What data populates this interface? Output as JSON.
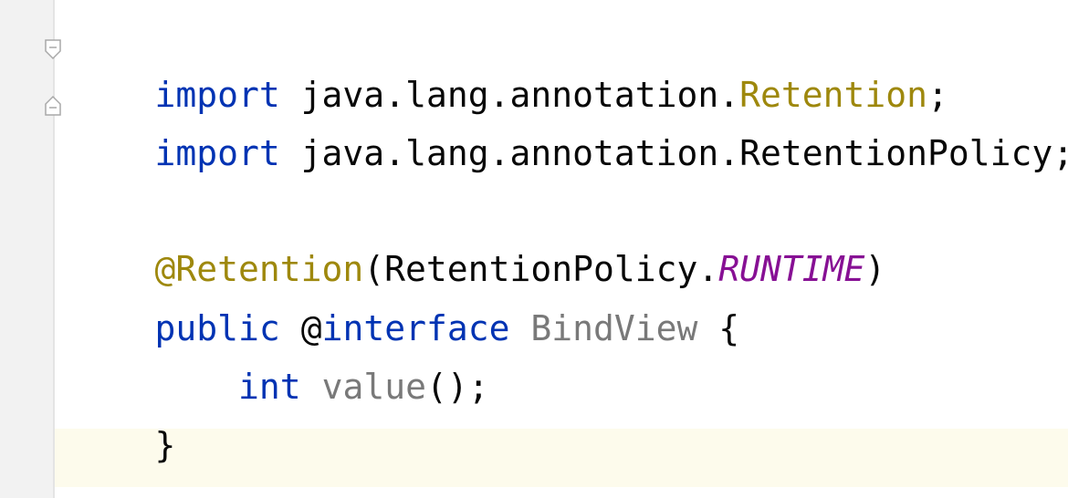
{
  "code": {
    "line1": {
      "keyword": "import",
      "package": " java.lang.annotation.",
      "class": "Retention",
      "end": ";"
    },
    "line2": {
      "keyword": "import",
      "rest": " java.lang.annotation.RetentionPolicy;"
    },
    "line4": {
      "annotation": "@Retention",
      "open": "(RetentionPolicy.",
      "constant": "RUNTIME",
      "close": ")"
    },
    "line5": {
      "keyword": "public",
      "space": " ",
      "at": "@",
      "interface_kw": "interface",
      "space2": " ",
      "name": "BindView",
      "brace": " {"
    },
    "line6": {
      "indent": "    ",
      "type": "int",
      "space": " ",
      "method": "value",
      "rest": "();"
    },
    "line7": {
      "brace": "}"
    }
  },
  "colors": {
    "keyword": "#0033b3",
    "annotation": "#9e880d",
    "constant": "#871094",
    "unused": "#797979",
    "text": "#080808",
    "caret_row": "#fdfbec",
    "gutter": "#f2f2f2"
  }
}
